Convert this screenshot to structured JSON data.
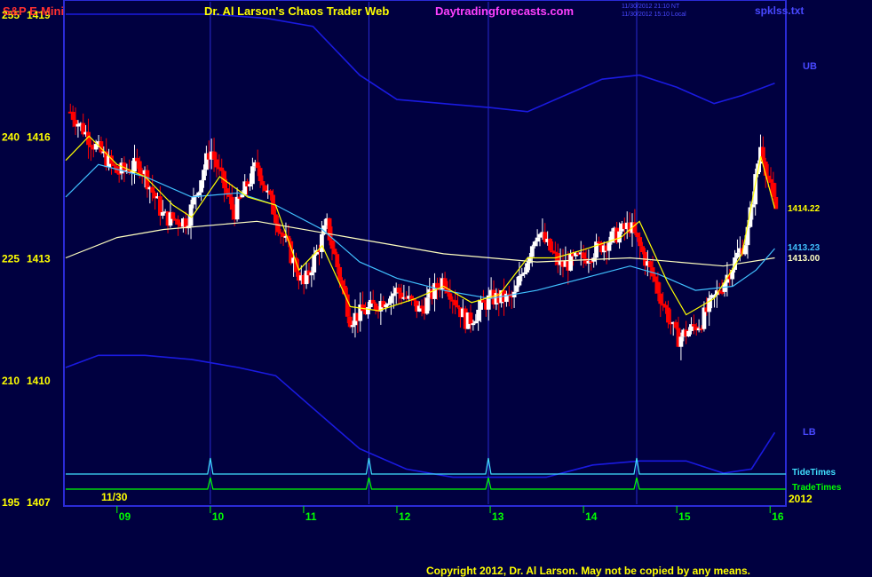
{
  "header": {
    "symbol": "S&P E-Mini",
    "title": "Dr. Al Larson's Chaos Trader Web",
    "site": "Daytradingforecasts.com",
    "timestamp_nt": "11/30/2012 21:10 NT",
    "timestamp_local": "11/30/2012 15:10 Local",
    "file": "spklss.txt"
  },
  "footer": {
    "copyright": "Copyright 2012, Dr. Al Larson. May not be copied by any means."
  },
  "colors": {
    "background": "#000040",
    "frame": "#2b2bd6",
    "up_bar": "#ffffff",
    "down_bar": "#ff0000",
    "ema_fast": "#ffff00",
    "ema_mid": "#40c0ff",
    "ema_slow": "#ffffc0",
    "bands": "#1a1ae0",
    "tide": "#40e0ff",
    "trade": "#00ff00",
    "time_labels": "#00ff00",
    "price_labels": "#ffff00",
    "title_color": "#ffff00",
    "site_color": "#ff40ff",
    "symbol_color": "#ff3030"
  },
  "chart_data": {
    "type": "candlestick",
    "date_label": "11/30",
    "year_label": "2012",
    "y_axis_labels": [
      {
        "index": "255",
        "price": "1419"
      },
      {
        "index": "240",
        "price": "1416"
      },
      {
        "index": "225",
        "price": "1413"
      },
      {
        "index": "210",
        "price": "1410"
      },
      {
        "index": "195",
        "price": "1407"
      }
    ],
    "ylim": [
      1407,
      1419
    ],
    "x_ticks": [
      "09",
      "10",
      "11",
      "12",
      "13",
      "14",
      "15",
      "16"
    ],
    "x_hours": [
      9,
      10,
      11,
      12,
      13,
      14,
      15,
      16
    ],
    "xlim": [
      8.45,
      16.15
    ],
    "band_labels": {
      "upper": "UB",
      "lower": "LB"
    },
    "event_lines": {
      "tide": "TideTimes",
      "trade": "TradeTimes"
    },
    "time_marker_hours": [
      10.0,
      11.7,
      12.98,
      14.57
    ],
    "price_tags": [
      {
        "value": "1414.22",
        "series": "ema_fast"
      },
      {
        "value": "1413.23",
        "series": "ema_mid"
      },
      {
        "value": "1413.00",
        "series": "ema_slow"
      }
    ],
    "anchors": {
      "close": [
        [
          8.5,
          1416.6
        ],
        [
          8.75,
          1415.8
        ],
        [
          9.0,
          1415.1
        ],
        [
          9.25,
          1415.3
        ],
        [
          9.5,
          1414.0
        ],
        [
          9.75,
          1413.9
        ],
        [
          10.0,
          1415.7
        ],
        [
          10.25,
          1414.1
        ],
        [
          10.5,
          1415.3
        ],
        [
          10.75,
          1413.7
        ],
        [
          11.0,
          1412.3
        ],
        [
          11.25,
          1413.8
        ],
        [
          11.5,
          1411.5
        ],
        [
          11.75,
          1411.8
        ],
        [
          12.0,
          1412.2
        ],
        [
          12.25,
          1411.7
        ],
        [
          12.5,
          1412.5
        ],
        [
          12.75,
          1411.4
        ],
        [
          13.0,
          1412.0
        ],
        [
          13.25,
          1412.0
        ],
        [
          13.5,
          1413.7
        ],
        [
          13.75,
          1412.8
        ],
        [
          14.0,
          1413.0
        ],
        [
          14.25,
          1413.4
        ],
        [
          14.5,
          1413.8
        ],
        [
          14.75,
          1412.5
        ],
        [
          15.0,
          1411.0
        ],
        [
          15.25,
          1411.4
        ],
        [
          15.5,
          1412.4
        ],
        [
          15.75,
          1413.5
        ],
        [
          15.9,
          1415.8
        ],
        [
          16.05,
          1414.2
        ]
      ],
      "ema_fast": [
        [
          8.45,
          1415.4
        ],
        [
          8.7,
          1416.0
        ],
        [
          9.0,
          1415.3
        ],
        [
          9.3,
          1415.0
        ],
        [
          9.6,
          1414.3
        ],
        [
          9.8,
          1414.0
        ],
        [
          10.1,
          1415.0
        ],
        [
          10.4,
          1414.5
        ],
        [
          10.7,
          1414.3
        ],
        [
          10.95,
          1412.7
        ],
        [
          11.2,
          1413.3
        ],
        [
          11.5,
          1411.8
        ],
        [
          11.8,
          1411.7
        ],
        [
          12.2,
          1412.0
        ],
        [
          12.5,
          1412.3
        ],
        [
          12.8,
          1411.9
        ],
        [
          13.1,
          1412.1
        ],
        [
          13.4,
          1413.0
        ],
        [
          13.7,
          1413.0
        ],
        [
          14.0,
          1413.2
        ],
        [
          14.4,
          1413.5
        ],
        [
          14.6,
          1413.9
        ],
        [
          14.9,
          1412.4
        ],
        [
          15.1,
          1411.6
        ],
        [
          15.4,
          1412.0
        ],
        [
          15.7,
          1413.1
        ],
        [
          15.9,
          1415.5
        ],
        [
          16.05,
          1414.22
        ]
      ],
      "ema_mid": [
        [
          8.45,
          1414.5
        ],
        [
          8.8,
          1415.3
        ],
        [
          9.3,
          1415.0
        ],
        [
          9.8,
          1414.5
        ],
        [
          10.3,
          1414.6
        ],
        [
          10.7,
          1414.3
        ],
        [
          11.2,
          1413.7
        ],
        [
          11.6,
          1412.9
        ],
        [
          12.0,
          1412.5
        ],
        [
          12.5,
          1412.2
        ],
        [
          13.0,
          1412.0
        ],
        [
          13.5,
          1412.2
        ],
        [
          14.0,
          1412.5
        ],
        [
          14.5,
          1412.8
        ],
        [
          14.8,
          1412.6
        ],
        [
          15.2,
          1412.2
        ],
        [
          15.6,
          1412.3
        ],
        [
          15.85,
          1412.7
        ],
        [
          16.05,
          1413.23
        ]
      ],
      "ema_slow": [
        [
          8.45,
          1413.0
        ],
        [
          9.0,
          1413.5
        ],
        [
          9.5,
          1413.7
        ],
        [
          10.5,
          1413.9
        ],
        [
          11.5,
          1413.5
        ],
        [
          12.5,
          1413.1
        ],
        [
          13.5,
          1412.9
        ],
        [
          14.5,
          1413.0
        ],
        [
          15.5,
          1412.8
        ],
        [
          16.05,
          1413.0
        ]
      ],
      "upper_band": [
        [
          8.45,
          1419.0
        ],
        [
          9.0,
          1419.0
        ],
        [
          10.0,
          1419.0
        ],
        [
          10.6,
          1418.9
        ],
        [
          11.1,
          1418.7
        ],
        [
          11.6,
          1417.5
        ],
        [
          12.0,
          1416.9
        ],
        [
          12.5,
          1416.8
        ],
        [
          13.0,
          1416.7
        ],
        [
          13.4,
          1416.6
        ],
        [
          13.8,
          1417.0
        ],
        [
          14.2,
          1417.4
        ],
        [
          14.6,
          1417.5
        ],
        [
          15.0,
          1417.2
        ],
        [
          15.4,
          1416.8
        ],
        [
          15.7,
          1417.0
        ],
        [
          16.05,
          1417.3
        ]
      ],
      "lower_band": [
        [
          8.45,
          1410.3
        ],
        [
          8.8,
          1410.6
        ],
        [
          9.3,
          1410.6
        ],
        [
          9.8,
          1410.5
        ],
        [
          10.3,
          1410.3
        ],
        [
          10.7,
          1410.1
        ],
        [
          11.1,
          1409.3
        ],
        [
          11.6,
          1408.3
        ],
        [
          12.1,
          1407.8
        ],
        [
          12.6,
          1407.6
        ],
        [
          13.1,
          1407.6
        ],
        [
          13.6,
          1407.6
        ],
        [
          14.1,
          1407.9
        ],
        [
          14.6,
          1408.0
        ],
        [
          15.1,
          1408.0
        ],
        [
          15.5,
          1407.7
        ],
        [
          15.8,
          1407.8
        ],
        [
          16.05,
          1408.7
        ]
      ]
    }
  }
}
